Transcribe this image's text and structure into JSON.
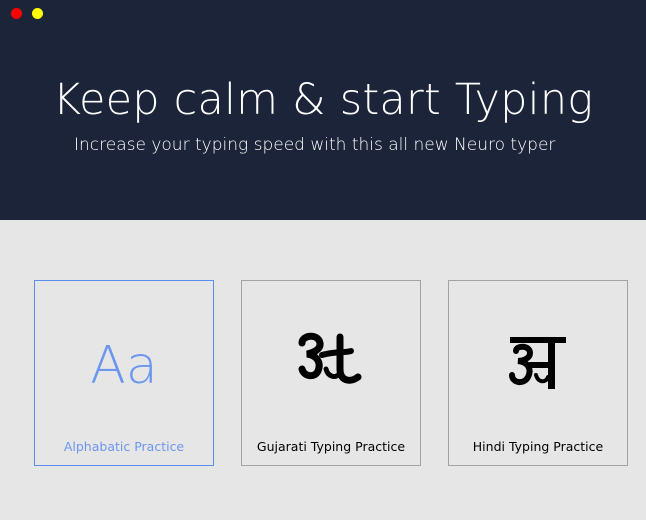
{
  "window": {
    "controls": [
      "close",
      "minimize"
    ],
    "colors": {
      "close": "#ff0000",
      "minimize": "#ffff00"
    }
  },
  "header": {
    "title": "Keep calm & start Typing",
    "subtitle": "Increase your typing speed with this all new Neuro typer",
    "background": "#1b2439"
  },
  "cards": [
    {
      "glyph": "Aa",
      "label": "Alphabatic Practice",
      "selected": true,
      "accent": "#6b96f0"
    },
    {
      "glyph": "gujarati-a-icon",
      "label": "Gujarati Typing Practice",
      "selected": false
    },
    {
      "glyph": "devanagari-a-icon",
      "label": "Hindi Typing Practice",
      "selected": false
    }
  ]
}
